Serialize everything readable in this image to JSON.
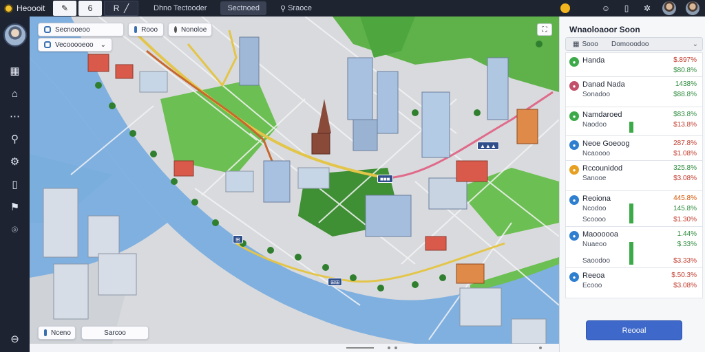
{
  "topbar": {
    "app_title": "Heoooit",
    "tools": [
      "✎",
      "6",
      "R"
    ],
    "tabs": [
      "Dhno Tectooder",
      "Sectnoed",
      "Sraoce"
    ],
    "active_tab": 1
  },
  "sidebar": {
    "icons": [
      "layers-icon",
      "home-icon",
      "route-icon",
      "search-icon",
      "settings-icon",
      "book-icon",
      "pin-icon",
      "location-icon"
    ],
    "glyphs": [
      "▦",
      "⌂",
      "⋯",
      "⚲",
      "⚙",
      "▯",
      "⚑",
      "⌾"
    ],
    "bottom_glyph": "⊖"
  },
  "map": {
    "search_pills": [
      {
        "label": "Secnooeoo"
      },
      {
        "label": "Rooo"
      },
      {
        "label": "Nonoloe"
      },
      {
        "label": "Vecooooeoo"
      }
    ],
    "bottom_pills": [
      {
        "label": "Nceno"
      },
      {
        "label": "Sarcoo"
      }
    ],
    "markers": [
      "▲▲▲",
      "■■■",
      "⊞",
      "⊞⊞"
    ]
  },
  "panel": {
    "title": "Wnaoloaoor Soon",
    "header_col1": "Sooo",
    "header_col2": "Domooodoo",
    "items": [
      {
        "name": "Handa",
        "sub": "",
        "val1": "$.897%",
        "val2": "$80.8%",
        "color": "#3daa4a",
        "val1_color": "#c0392b",
        "val2_color": "#2e8b3d",
        "bar_color": "",
        "bar_level": 0
      },
      {
        "name": "Danad Nada",
        "sub": "Sonadoo",
        "val1": "1438%",
        "val2": "$88.8%",
        "color": "#c2506a",
        "val1_color": "#2e8b3d",
        "val2_color": "#2e8b3d",
        "bar_color": "",
        "bar_level": 0
      },
      {
        "name": "Namdaroed",
        "sub": "Naodoo",
        "val1": "$83.8%",
        "val2": "$13.8%",
        "color": "#3daa4a",
        "val1_color": "#2e8b3d",
        "val2_color": "#c0392b",
        "bar_color": "#3daa4a",
        "bar_level": 0.5
      },
      {
        "name": "Neoe Goeoog",
        "sub": "Ncaoooo",
        "val1": "287.8%",
        "val2": "$1.08%",
        "color": "#2f7fd0",
        "val1_color": "#c0392b",
        "val2_color": "#c0392b",
        "bar_color": "",
        "bar_level": 0
      },
      {
        "name": "Rccounidod",
        "sub": "Sanooe",
        "val1": "325.8%",
        "val2": "$3.08%",
        "color": "#e8a022",
        "val1_color": "#2e8b3d",
        "val2_color": "#c0392b",
        "bar_color": "",
        "bar_level": 0
      },
      {
        "name": "Reoiona",
        "sub": "Ncodoo",
        "val1": "445.8%",
        "val2": "145.8%",
        "val3": "$1.30%",
        "sub2": "Scoooo",
        "color": "#2f7fd0",
        "val1_color": "#d35400",
        "val2_color": "#2e8b3d",
        "val3_color": "#c0392b",
        "bar_color": "#3daa4a",
        "bar_level": 0.7
      },
      {
        "name": "Maoooooa",
        "sub": "Nuaeoo",
        "val1": "1.44%",
        "val2": "$.33%",
        "val3": "$3.33%",
        "sub2": "Saoodoo",
        "color": "#2f7fd0",
        "val1_color": "#2e8b3d",
        "val2_color": "#2e8b3d",
        "val3_color": "#c0392b",
        "bar_color": "#3daa4a",
        "bar_level": 0.65
      },
      {
        "name": "Reeoa",
        "sub": "Ecooo",
        "val1": "$.50.3%",
        "val2": "$3.08%",
        "color": "#2f7fd0",
        "val1_color": "#c0392b",
        "val2_color": "#c0392b",
        "bar_color": "",
        "bar_level": 0
      }
    ],
    "button_label": "Reooal"
  }
}
